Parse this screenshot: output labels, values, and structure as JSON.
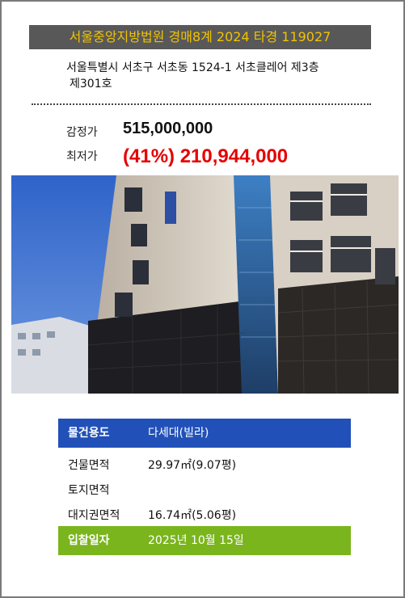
{
  "header": {
    "title": "서울중앙지방법원 경매8계 2024 타경 119027"
  },
  "address": {
    "line1": "서울특별시 서초구 서초동 1524-1 서초클레어 제3층",
    "line2": "제301호"
  },
  "prices": {
    "appraisal_label": "감정가",
    "appraisal_value": "515,000,000",
    "minimum_label": "최저가",
    "minimum_value": "(41%) 210,944,000"
  },
  "details": {
    "use_label": "물건용도",
    "use_value": "다세대(빌라)",
    "building_area_label": "건물면적",
    "building_area_value": "29.97㎡(9.07평)",
    "land_area_label": "토지면적",
    "land_area_value": "",
    "land_rights_label": "대지권면적",
    "land_rights_value": "16.74㎡(5.06평)",
    "bid_date_label": "입찰일자",
    "bid_date_value": "2025년 10월 15일"
  },
  "colors": {
    "title_bg": "#585858",
    "title_text": "#f2c300",
    "minimum_price": "#e60000",
    "use_row": "#2150b8",
    "bid_row": "#7ab51d"
  }
}
